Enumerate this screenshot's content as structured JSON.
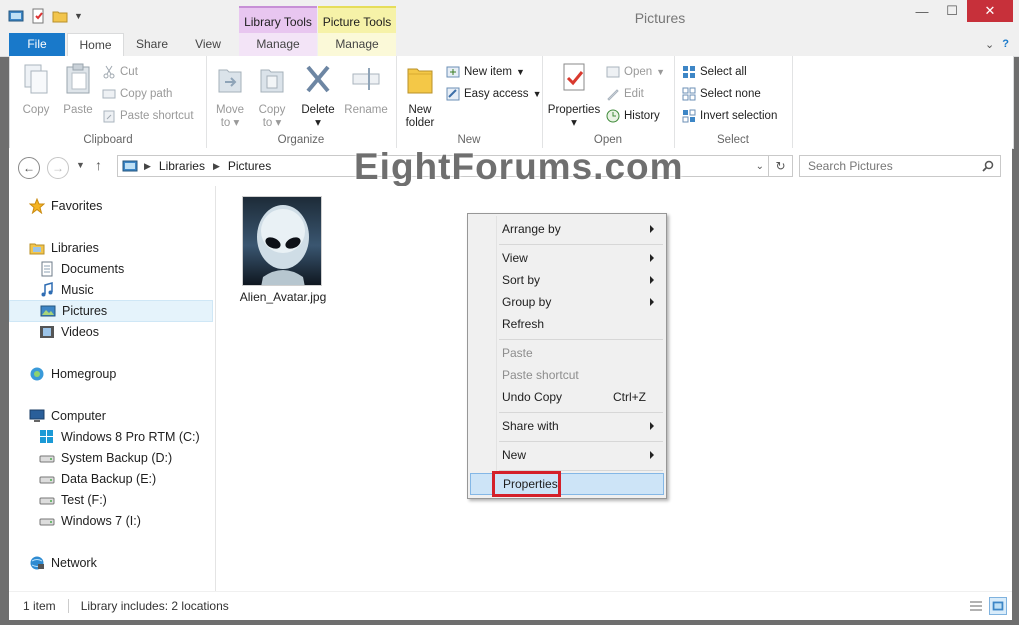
{
  "window": {
    "title": "Pictures",
    "context_tabs": [
      "Library Tools",
      "Picture Tools"
    ],
    "controls": {
      "minimize": "—",
      "maximize": "☐",
      "close": "✕"
    }
  },
  "ribbon_tabs": [
    "File",
    "Home",
    "Share",
    "View",
    "Manage",
    "Manage"
  ],
  "ribbon": {
    "clipboard": {
      "label": "Clipboard",
      "copy": "Copy",
      "paste": "Paste",
      "cut": "Cut",
      "copy_path": "Copy path",
      "paste_shortcut": "Paste shortcut"
    },
    "organize": {
      "label": "Organize",
      "move_to": "Move",
      "move_to2": "to",
      "copy_to": "Copy",
      "copy_to2": "to",
      "delete": "Delete",
      "rename": "Rename"
    },
    "new": {
      "label": "New",
      "new_folder": "New",
      "new_folder2": "folder",
      "new_item": "New item",
      "easy_access": "Easy access"
    },
    "open": {
      "label": "Open",
      "properties": "Properties",
      "open": "Open",
      "edit": "Edit",
      "history": "History"
    },
    "select": {
      "label": "Select",
      "select_all": "Select all",
      "select_none": "Select none",
      "invert": "Invert selection"
    }
  },
  "address": {
    "crumbs": [
      "Libraries",
      "Pictures"
    ],
    "search_placeholder": "Search Pictures"
  },
  "watermark": "EightForums.com",
  "nav": {
    "favorites": "Favorites",
    "libraries": "Libraries",
    "documents": "Documents",
    "music": "Music",
    "pictures": "Pictures",
    "videos": "Videos",
    "homegroup": "Homegroup",
    "computer": "Computer",
    "drive_c": "Windows 8 Pro RTM (C:)",
    "drive_d": "System Backup (D:)",
    "drive_e": "Data Backup (E:)",
    "drive_f": "Test (F:)",
    "drive_i": "Windows 7 (I:)",
    "network": "Network"
  },
  "files": [
    {
      "name": "Alien_Avatar.jpg"
    }
  ],
  "status": {
    "count": "1 item",
    "library": "Library includes: 2 locations"
  },
  "context_menu": {
    "arrange_by": "Arrange by",
    "view": "View",
    "sort_by": "Sort by",
    "group_by": "Group by",
    "refresh": "Refresh",
    "paste": "Paste",
    "paste_shortcut": "Paste shortcut",
    "undo_copy": "Undo Copy",
    "undo_shortcut": "Ctrl+Z",
    "share_with": "Share with",
    "new": "New",
    "properties": "Properties"
  },
  "colors": {
    "file_tab": "#1979ca",
    "highlight": "#d4202a",
    "selection": "#cde4f7"
  }
}
